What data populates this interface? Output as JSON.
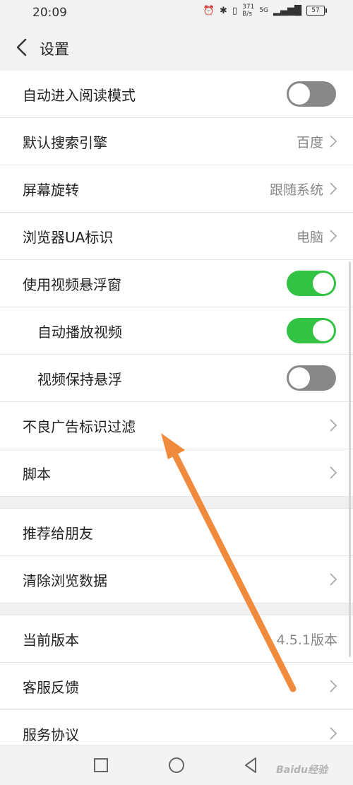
{
  "status_bar": {
    "time": "20:09",
    "net_rate_value": "371",
    "net_rate_unit": "B/s",
    "network": "5G",
    "battery": "57"
  },
  "header": {
    "title": "设置"
  },
  "settings": {
    "reading_mode": {
      "label": "自动进入阅读模式",
      "toggle": "off"
    },
    "search_engine": {
      "label": "默认搜索引擎",
      "value": "百度"
    },
    "rotation": {
      "label": "屏幕旋转",
      "value": "跟随系统"
    },
    "ua": {
      "label": "浏览器UA标识",
      "value": "电脑"
    },
    "video_float": {
      "label": "使用视频悬浮窗",
      "toggle": "on"
    },
    "autoplay": {
      "label": "自动播放视频",
      "toggle": "on"
    },
    "keep_float": {
      "label": "视频保持悬浮",
      "toggle": "off"
    },
    "ad_filter": {
      "label": "不良广告标识过滤"
    },
    "script": {
      "label": "脚本"
    },
    "recommend": {
      "label": "推荐给朋友"
    },
    "clear_data": {
      "label": "清除浏览数据"
    },
    "version": {
      "label": "当前版本",
      "value": "4.5.1版本"
    },
    "feedback": {
      "label": "客服反馈"
    },
    "agreement": {
      "label": "服务协议"
    }
  },
  "watermark": "Baidu经验",
  "colors": {
    "toggle_on": "#32c344",
    "toggle_off": "#888888",
    "annotation_arrow": "#f08a3c"
  }
}
